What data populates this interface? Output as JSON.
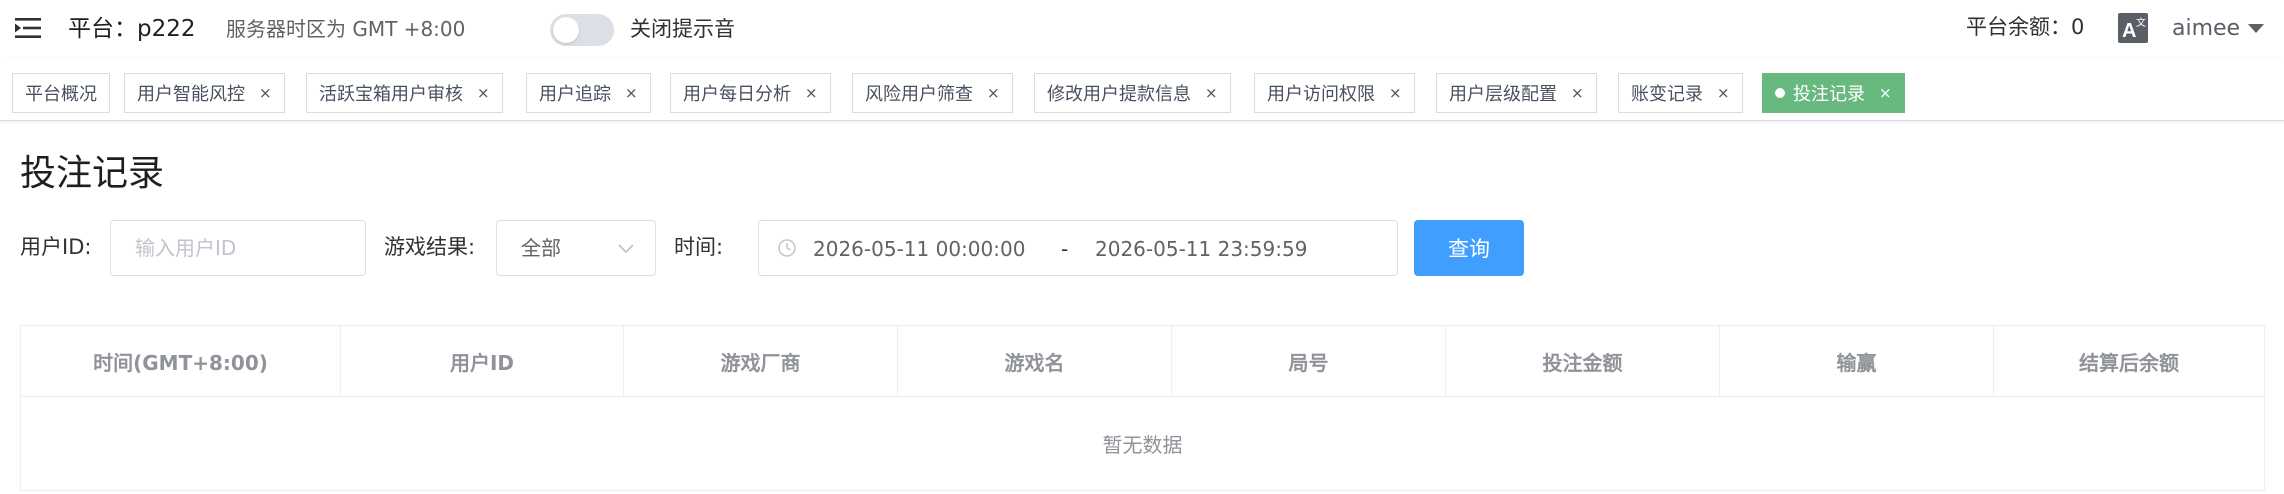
{
  "header": {
    "platform_label": "平台：",
    "platform_name": "p222",
    "server_timezone": "服务器时区为 GMT +8:00",
    "sound_toggle_label": "关闭提示音",
    "sound_toggle_on": false,
    "balance_label": "平台余额：",
    "balance_value": "0",
    "username": "aimee"
  },
  "tags": [
    {
      "label": "平台概况",
      "closable": false,
      "active": false
    },
    {
      "label": "用户智能风控",
      "closable": true,
      "active": false
    },
    {
      "label": "活跃宝箱用户审核",
      "closable": true,
      "active": false
    },
    {
      "label": "用户追踪",
      "closable": true,
      "active": false
    },
    {
      "label": "用户每日分析",
      "closable": true,
      "active": false
    },
    {
      "label": "风险用户筛查",
      "closable": true,
      "active": false
    },
    {
      "label": "修改用户提款信息",
      "closable": true,
      "active": false
    },
    {
      "label": "用户访问权限",
      "closable": true,
      "active": false
    },
    {
      "label": "用户层级配置",
      "closable": true,
      "active": false
    },
    {
      "label": "账变记录",
      "closable": true,
      "active": false
    },
    {
      "label": "投注记录",
      "closable": true,
      "active": true
    }
  ],
  "tag_close_glyph": "×",
  "page": {
    "title": "投注记录"
  },
  "filters": {
    "user_id_label": "用户ID:",
    "user_id_placeholder": "输入用户ID",
    "user_id_value": "",
    "result_label": "游戏结果:",
    "result_selected": "全部",
    "time_label": "时间:",
    "time_start": "2026-05-11 00:00:00",
    "time_separator": "-",
    "time_end": "2026-05-11 23:59:59",
    "query_button": "查询"
  },
  "table": {
    "columns": [
      "时间(GMT+8:00)",
      "用户ID",
      "游戏厂商",
      "游戏名",
      "局号",
      "投注金额",
      "输赢",
      "结算后余额"
    ],
    "rows": [],
    "empty_text": "暂无数据"
  },
  "colors": {
    "primary": "#409eff",
    "active_tag": "#67b97f",
    "border": "#dcdfe6",
    "muted_text": "#909399"
  },
  "icons": {
    "menu": "hamburger-menu-icon",
    "language": "translate-icon",
    "dropdown": "caret-down-icon",
    "select_arrow": "chevron-down-icon",
    "clock": "clock-icon"
  }
}
